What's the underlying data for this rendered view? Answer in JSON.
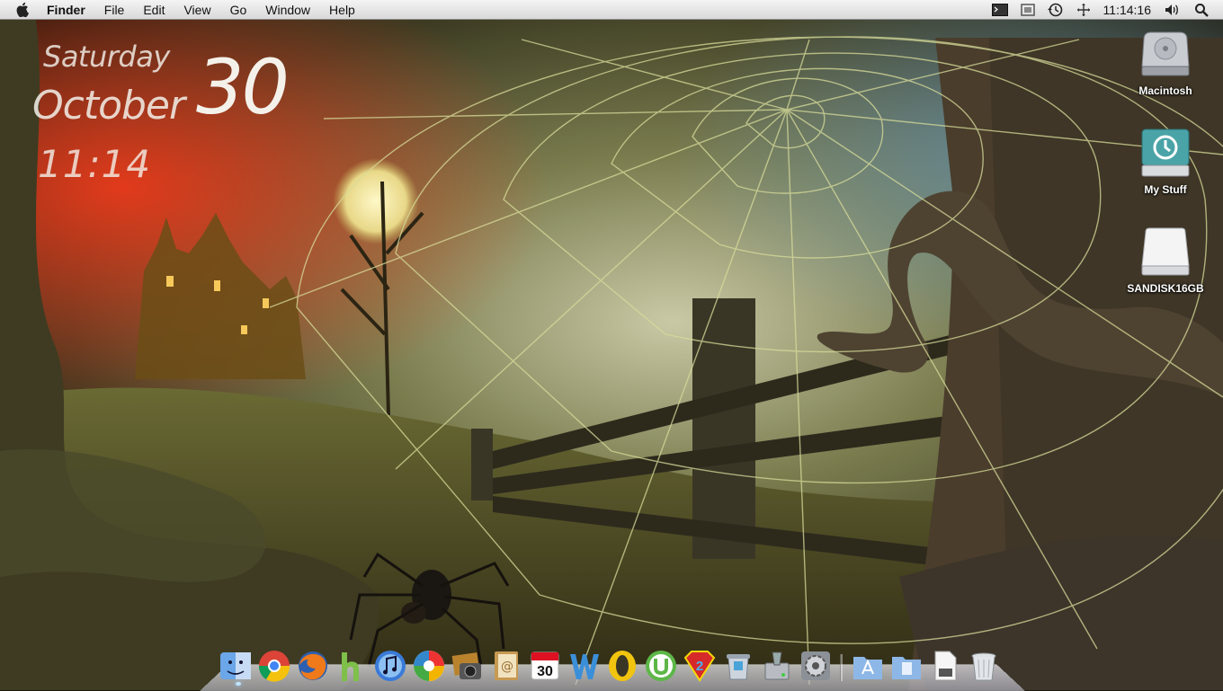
{
  "menubar": {
    "app_name": "Finder",
    "menus": [
      "File",
      "Edit",
      "View",
      "Go",
      "Window",
      "Help"
    ],
    "status_icons": [
      "terminal-icon",
      "display-icon",
      "time-machine-icon",
      "spaces-icon"
    ],
    "clock": "11:14:16",
    "volume_icon": "volume-icon",
    "search_icon": "spotlight-icon"
  },
  "widget": {
    "day": "Saturday",
    "month": "October",
    "date": "30",
    "time": "11:14"
  },
  "desktop": {
    "icons": [
      {
        "label": "Macintosh",
        "icon": "hard-drive-icon"
      },
      {
        "label": "My Stuff",
        "icon": "time-machine-drive-icon"
      },
      {
        "label": "SANDISK16GB",
        "icon": "external-drive-icon"
      }
    ]
  },
  "dock": {
    "items": [
      "finder-icon",
      "chrome-icon",
      "firefox-icon",
      "hulu-icon",
      "itunes-icon",
      "picasa-icon",
      "iphoto-icon",
      "address-book-icon",
      "ical-icon",
      "word-icon",
      "opera-icon",
      "utorrent-icon",
      "superman-icon",
      "utility-icon",
      "disk-utility-icon",
      "system-preferences-icon",
      "applications-folder-icon",
      "documents-folder-icon",
      "file-icon",
      "trash-icon"
    ],
    "ical_date": "30"
  },
  "colors": {
    "menubar_bg": "#e8e8e8",
    "widget_text": "#f4f1ea",
    "web_color": "#d8dc9a"
  }
}
